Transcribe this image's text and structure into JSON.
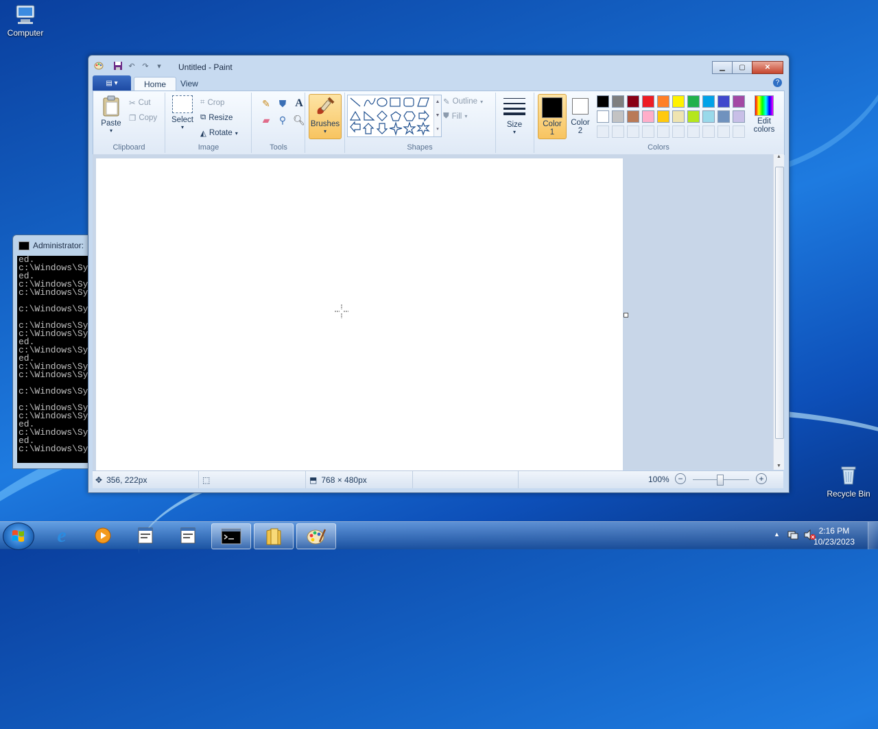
{
  "desktop": {
    "icons": [
      {
        "label": "Computer",
        "icon": "computer-icon"
      },
      {
        "label": "Recycle Bin",
        "icon": "recycle-bin-icon"
      }
    ]
  },
  "cmd": {
    "title": "Administrator:",
    "lines": [
      "ed.",
      "c:\\Windows\\Sy",
      "ed.",
      "c:\\Windows\\Sy",
      "c:\\Windows\\Sy",
      "",
      "c:\\Windows\\Sy",
      "",
      "c:\\Windows\\Sy",
      "c:\\Windows\\Sy",
      "ed.",
      "c:\\Windows\\Sy",
      "ed.",
      "c:\\Windows\\Sy",
      "c:\\Windows\\Sy",
      "",
      "c:\\Windows\\Sy",
      "",
      "c:\\Windows\\Sy",
      "c:\\Windows\\Sy",
      "ed.",
      "c:\\Windows\\Sy",
      "ed.",
      "c:\\Windows\\Sy"
    ]
  },
  "paint": {
    "title": "Untitled - Paint",
    "tabs": [
      "Home",
      "View"
    ],
    "clipboard": {
      "paste": "Paste",
      "cut": "Cut",
      "copy": "Copy",
      "label": "Clipboard"
    },
    "image": {
      "select": "Select",
      "crop": "Crop",
      "resize": "Resize",
      "rotate": "Rotate",
      "label": "Image"
    },
    "tools": {
      "label": "Tools"
    },
    "brushes": {
      "label": "Brushes"
    },
    "shapes": {
      "outline": "Outline",
      "fill": "Fill",
      "label": "Shapes"
    },
    "size": {
      "label": "Size"
    },
    "colors": {
      "color1": "Color",
      "color1_num": "1",
      "color2": "Color",
      "color2_num": "2",
      "edit": "Edit",
      "edit2": "colors",
      "label": "Colors",
      "color1_value": "#000000",
      "color2_value": "#ffffff",
      "palette_row1": [
        "#000000",
        "#7f7f7f",
        "#880015",
        "#ed1c24",
        "#ff7f27",
        "#fff200",
        "#22b14c",
        "#00a2e8",
        "#3f48cc",
        "#a349a4"
      ],
      "palette_row2": [
        "#ffffff",
        "#c3c3c3",
        "#b97a57",
        "#ffaec9",
        "#ffc90e",
        "#efe4b0",
        "#b5e61d",
        "#99d9ea",
        "#7092be",
        "#c8bfe7"
      ]
    },
    "status": {
      "cursor_pos": "356, 222px",
      "image_size": "768 × 480px",
      "zoom": "100%"
    }
  },
  "taskbar": {
    "time": "2:16 PM",
    "date": "10/23/2023"
  }
}
